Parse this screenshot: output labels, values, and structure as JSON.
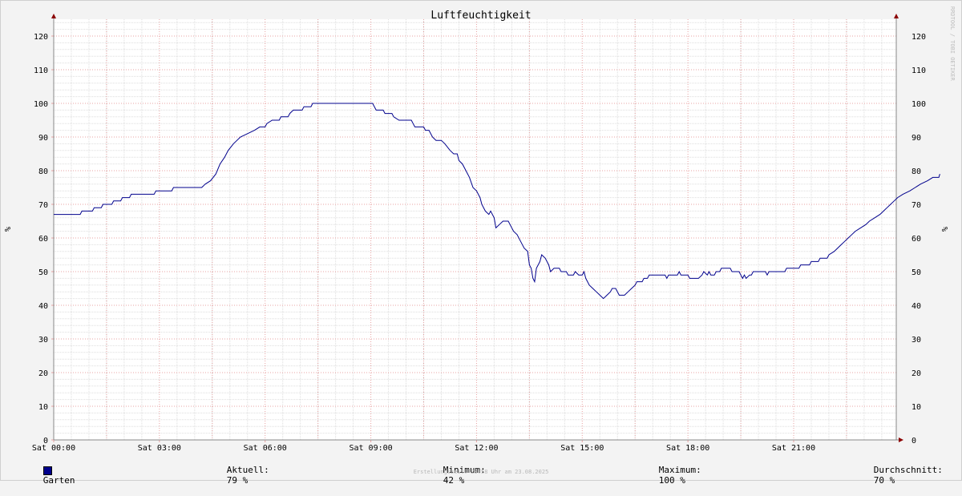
{
  "chart_data": {
    "type": "line",
    "title": "Luftfeuchtigkeit",
    "ylabel_left": "%",
    "ylabel_right": "%",
    "ylim": [
      0,
      125
    ],
    "yticks": [
      0,
      10,
      20,
      30,
      40,
      50,
      60,
      70,
      80,
      90,
      100,
      110,
      120
    ],
    "xlim_hours": [
      0,
      24
    ],
    "xticks": [
      {
        "h": 0,
        "label": "Sat 00:00"
      },
      {
        "h": 3,
        "label": "Sat 03:00"
      },
      {
        "h": 6,
        "label": "Sat 06:00"
      },
      {
        "h": 9,
        "label": "Sat 09:00"
      },
      {
        "h": 12,
        "label": "Sat 12:00"
      },
      {
        "h": 15,
        "label": "Sat 15:00"
      },
      {
        "h": 18,
        "label": "Sat 18:00"
      },
      {
        "h": 21,
        "label": "Sat 21:00"
      }
    ],
    "grid": true,
    "series": [
      {
        "name": "Garten",
        "color": "#00008c",
        "points": [
          [
            0,
            67
          ],
          [
            0.75,
            67
          ],
          [
            0.8,
            68
          ],
          [
            1.1,
            68
          ],
          [
            1.15,
            69
          ],
          [
            1.35,
            69
          ],
          [
            1.4,
            70
          ],
          [
            1.65,
            70
          ],
          [
            1.7,
            71
          ],
          [
            1.9,
            71
          ],
          [
            1.95,
            72
          ],
          [
            2.15,
            72
          ],
          [
            2.2,
            73
          ],
          [
            2.85,
            73
          ],
          [
            2.9,
            74
          ],
          [
            3.35,
            74
          ],
          [
            3.4,
            75
          ],
          [
            4.2,
            75
          ],
          [
            4.3,
            76
          ],
          [
            4.45,
            77
          ],
          [
            4.6,
            79
          ],
          [
            4.72,
            82
          ],
          [
            4.85,
            84
          ],
          [
            4.95,
            86
          ],
          [
            5.1,
            88
          ],
          [
            5.3,
            90
          ],
          [
            5.5,
            91
          ],
          [
            5.7,
            92
          ],
          [
            5.85,
            93
          ],
          [
            6.0,
            93
          ],
          [
            6.05,
            94
          ],
          [
            6.2,
            95
          ],
          [
            6.4,
            95
          ],
          [
            6.45,
            96
          ],
          [
            6.65,
            96
          ],
          [
            6.7,
            97
          ],
          [
            6.8,
            98
          ],
          [
            7.05,
            98
          ],
          [
            7.1,
            99
          ],
          [
            7.3,
            99
          ],
          [
            7.35,
            100
          ],
          [
            9.05,
            100
          ],
          [
            9.15,
            98
          ],
          [
            9.35,
            98
          ],
          [
            9.4,
            97
          ],
          [
            9.6,
            97
          ],
          [
            9.65,
            96
          ],
          [
            9.8,
            95
          ],
          [
            10.15,
            95
          ],
          [
            10.2,
            94
          ],
          [
            10.25,
            93
          ],
          [
            10.5,
            93
          ],
          [
            10.55,
            92
          ],
          [
            10.65,
            92
          ],
          [
            10.75,
            90
          ],
          [
            10.85,
            89
          ],
          [
            11.0,
            89
          ],
          [
            11.1,
            88
          ],
          [
            11.25,
            86
          ],
          [
            11.35,
            85
          ],
          [
            11.45,
            85
          ],
          [
            11.5,
            83
          ],
          [
            11.6,
            82
          ],
          [
            11.7,
            80
          ],
          [
            11.8,
            78
          ],
          [
            11.9,
            75
          ],
          [
            12.0,
            74
          ],
          [
            12.1,
            72
          ],
          [
            12.15,
            70
          ],
          [
            12.25,
            68
          ],
          [
            12.35,
            67
          ],
          [
            12.4,
            68
          ],
          [
            12.5,
            66
          ],
          [
            12.55,
            63
          ],
          [
            12.65,
            64
          ],
          [
            12.75,
            65
          ],
          [
            12.9,
            65
          ],
          [
            12.95,
            64
          ],
          [
            13.05,
            62
          ],
          [
            13.15,
            61
          ],
          [
            13.25,
            59
          ],
          [
            13.35,
            57
          ],
          [
            13.45,
            56
          ],
          [
            13.5,
            52
          ],
          [
            13.55,
            51
          ],
          [
            13.6,
            48
          ],
          [
            13.65,
            47
          ],
          [
            13.7,
            51
          ],
          [
            13.8,
            53
          ],
          [
            13.85,
            55
          ],
          [
            13.95,
            54
          ],
          [
            14.05,
            52
          ],
          [
            14.1,
            50
          ],
          [
            14.2,
            51
          ],
          [
            14.35,
            51
          ],
          [
            14.4,
            50
          ],
          [
            14.55,
            50
          ],
          [
            14.6,
            49
          ],
          [
            14.75,
            49
          ],
          [
            14.8,
            50
          ],
          [
            14.9,
            49
          ],
          [
            15.0,
            49
          ],
          [
            15.05,
            50
          ],
          [
            15.1,
            48
          ],
          [
            15.2,
            46
          ],
          [
            15.3,
            45
          ],
          [
            15.4,
            44
          ],
          [
            15.5,
            43
          ],
          [
            15.6,
            42
          ],
          [
            15.7,
            43
          ],
          [
            15.8,
            44
          ],
          [
            15.85,
            45
          ],
          [
            15.95,
            45
          ],
          [
            16.0,
            44
          ],
          [
            16.05,
            43
          ],
          [
            16.2,
            43
          ],
          [
            16.3,
            44
          ],
          [
            16.4,
            45
          ],
          [
            16.5,
            46
          ],
          [
            16.55,
            47
          ],
          [
            16.7,
            47
          ],
          [
            16.75,
            48
          ],
          [
            16.85,
            48
          ],
          [
            16.9,
            49
          ],
          [
            17.35,
            49
          ],
          [
            17.4,
            48
          ],
          [
            17.45,
            49
          ],
          [
            17.7,
            49
          ],
          [
            17.75,
            50
          ],
          [
            17.8,
            49
          ],
          [
            18.0,
            49
          ],
          [
            18.05,
            48
          ],
          [
            18.3,
            48
          ],
          [
            18.4,
            49
          ],
          [
            18.45,
            50
          ],
          [
            18.55,
            49
          ],
          [
            18.6,
            50
          ],
          [
            18.65,
            49
          ],
          [
            18.75,
            49
          ],
          [
            18.8,
            50
          ],
          [
            18.9,
            50
          ],
          [
            18.95,
            51
          ],
          [
            19.2,
            51
          ],
          [
            19.25,
            50
          ],
          [
            19.45,
            50
          ],
          [
            19.5,
            49
          ],
          [
            19.55,
            48
          ],
          [
            19.6,
            49
          ],
          [
            19.65,
            48
          ],
          [
            19.75,
            49
          ],
          [
            19.8,
            49
          ],
          [
            19.85,
            50
          ],
          [
            20.2,
            50
          ],
          [
            20.25,
            49
          ],
          [
            20.3,
            50
          ],
          [
            20.75,
            50
          ],
          [
            20.8,
            51
          ],
          [
            21.15,
            51
          ],
          [
            21.2,
            52
          ],
          [
            21.45,
            52
          ],
          [
            21.5,
            53
          ],
          [
            21.7,
            53
          ],
          [
            21.75,
            54
          ],
          [
            21.95,
            54
          ],
          [
            22.0,
            55
          ],
          [
            22.15,
            56
          ],
          [
            22.25,
            57
          ],
          [
            22.35,
            58
          ],
          [
            22.45,
            59
          ],
          [
            22.55,
            60
          ],
          [
            22.65,
            61
          ],
          [
            22.75,
            62
          ],
          [
            22.9,
            63
          ],
          [
            23.05,
            64
          ],
          [
            23.15,
            65
          ],
          [
            23.3,
            66
          ],
          [
            23.45,
            67
          ],
          [
            23.55,
            68
          ],
          [
            23.65,
            69
          ],
          [
            23.75,
            70
          ],
          [
            23.85,
            71
          ],
          [
            23.95,
            72
          ],
          [
            24.1,
            73
          ],
          [
            24.3,
            74
          ],
          [
            24.45,
            75
          ],
          [
            24.6,
            76
          ],
          [
            24.8,
            77
          ],
          [
            24.95,
            78
          ],
          [
            25.12,
            78
          ],
          [
            25.15,
            79
          ]
        ]
      }
    ],
    "legend": {
      "series_label": "Garten",
      "current_label": "Aktuell:",
      "current_value": "79 %",
      "min_label": "Minimum:",
      "min_value": "42 %",
      "max_label": "Maximum:",
      "max_value": "100 %",
      "avg_label": "Durchschnitt:",
      "avg_value": "70 %"
    },
    "footer": "Erstellungszeit: 23:58 Uhr am 23.08.2025",
    "watermark": "RRDTOOL / TOBI OETIKER"
  }
}
